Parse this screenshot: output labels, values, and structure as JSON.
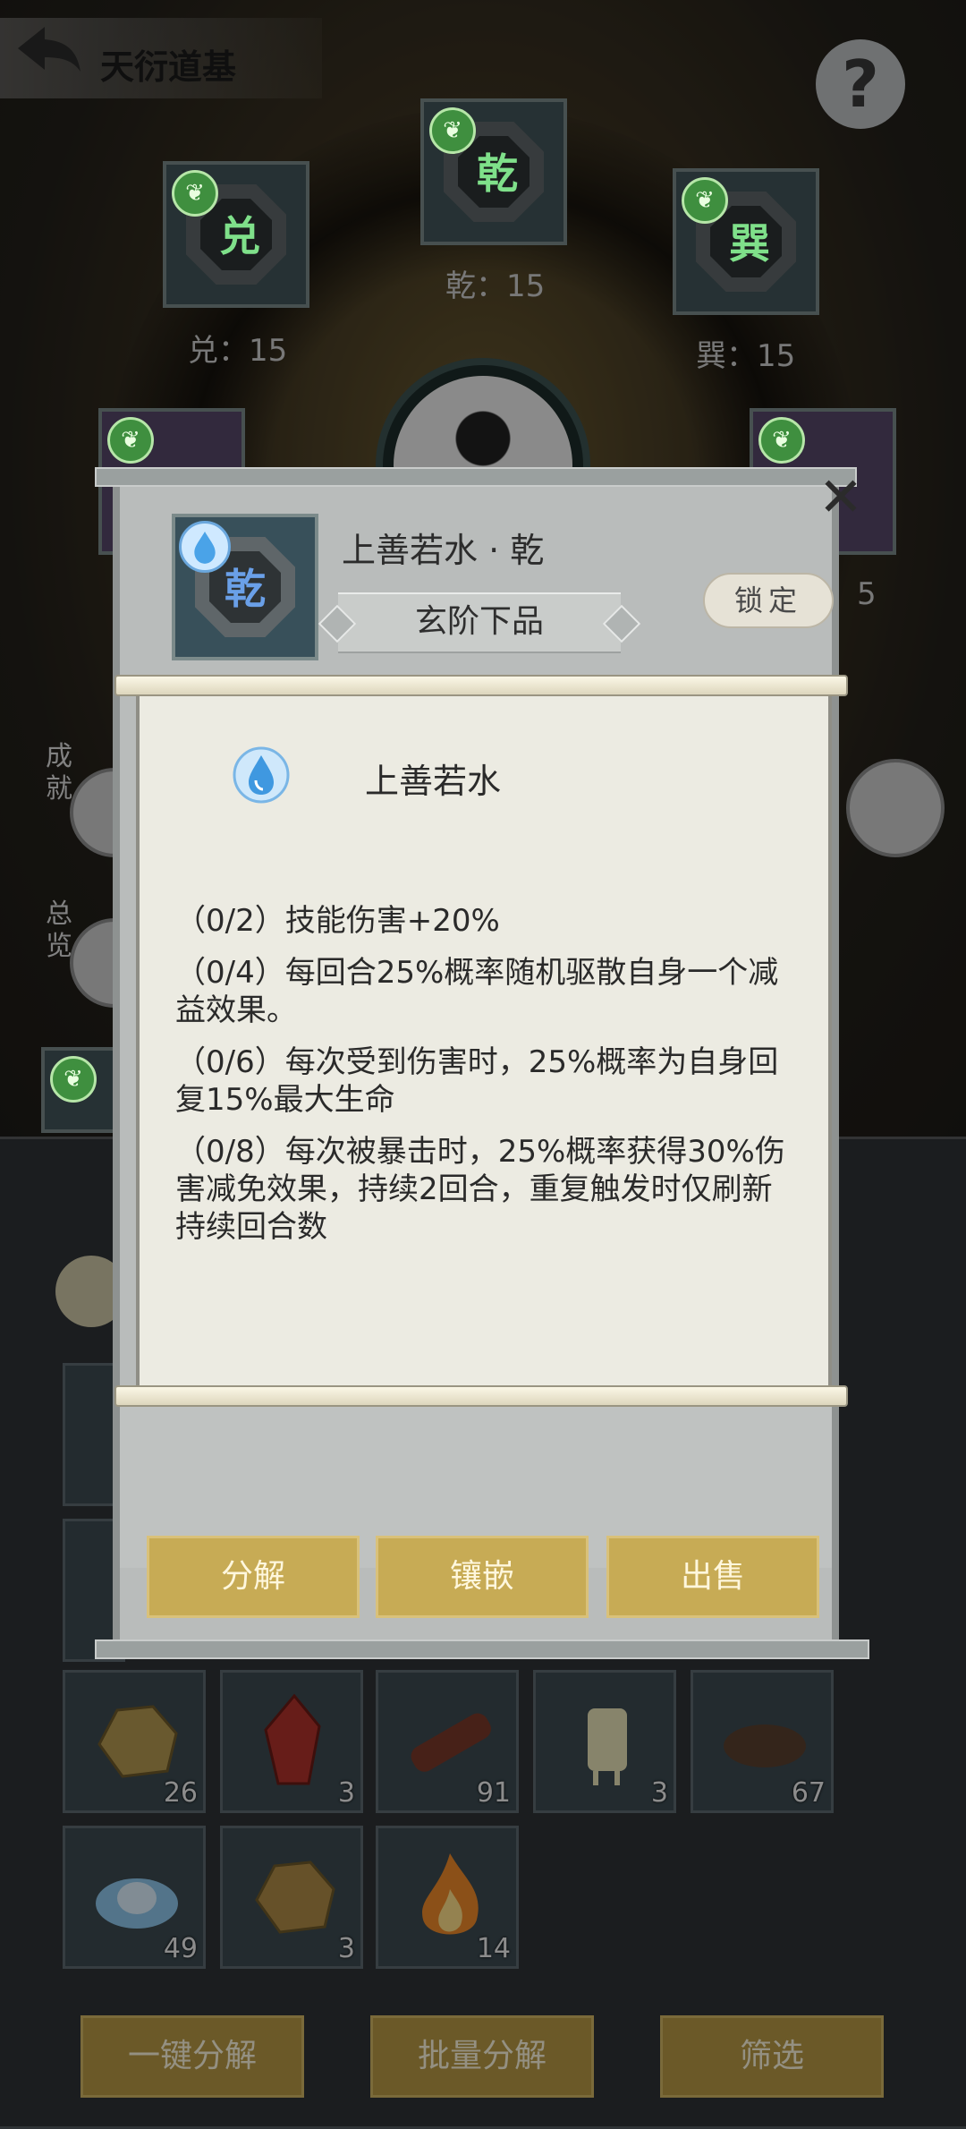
{
  "header": {
    "title": "天衍道基",
    "help_glyph": "?"
  },
  "sockets": [
    {
      "glyph": "兑",
      "label": "兑：15"
    },
    {
      "glyph": "乾",
      "label": "乾：15"
    },
    {
      "glyph": "巽",
      "label": "巽：15"
    }
  ],
  "side": {
    "achievements_label": "成就",
    "overview_label": "总览",
    "right_partial_count": "5"
  },
  "modal": {
    "item_name": "上善若水 · 乾",
    "item_glyph": "乾",
    "grade": "玄阶下品",
    "lock_label": "锁定",
    "set_name": "上善若水",
    "bonuses": [
      "（0/2）技能伤害+20%",
      "（0/4）每回合25%概率随机驱散自身一个减益效果。",
      "（0/6）每次受到伤害时，25%概率为自身回复15%最大生命",
      "（0/8）每次被暴击时，25%概率获得30%伤害减免效果，持续2回合，重复触发时仅刷新持续回合数"
    ],
    "buttons": {
      "decompose": "分解",
      "inlay": "镶嵌",
      "sell": "出售"
    },
    "close_glyph": "✕"
  },
  "inventory": {
    "items": [
      {
        "name": "ore-icon",
        "count": "26"
      },
      {
        "name": "red-crystal-icon",
        "count": "3"
      },
      {
        "name": "wood-log-icon",
        "count": "91"
      },
      {
        "name": "wax-candle-icon",
        "count": "3"
      },
      {
        "name": "soil-pile-icon",
        "count": "67"
      },
      {
        "name": "ice-lotus-icon",
        "count": "49"
      },
      {
        "name": "gold-ore-icon",
        "count": "3"
      },
      {
        "name": "flame-icon",
        "count": "14"
      }
    ]
  },
  "bottom_bar": {
    "one_key_decompose": "一键分解",
    "batch_decompose": "批量分解",
    "filter": "筛选"
  }
}
